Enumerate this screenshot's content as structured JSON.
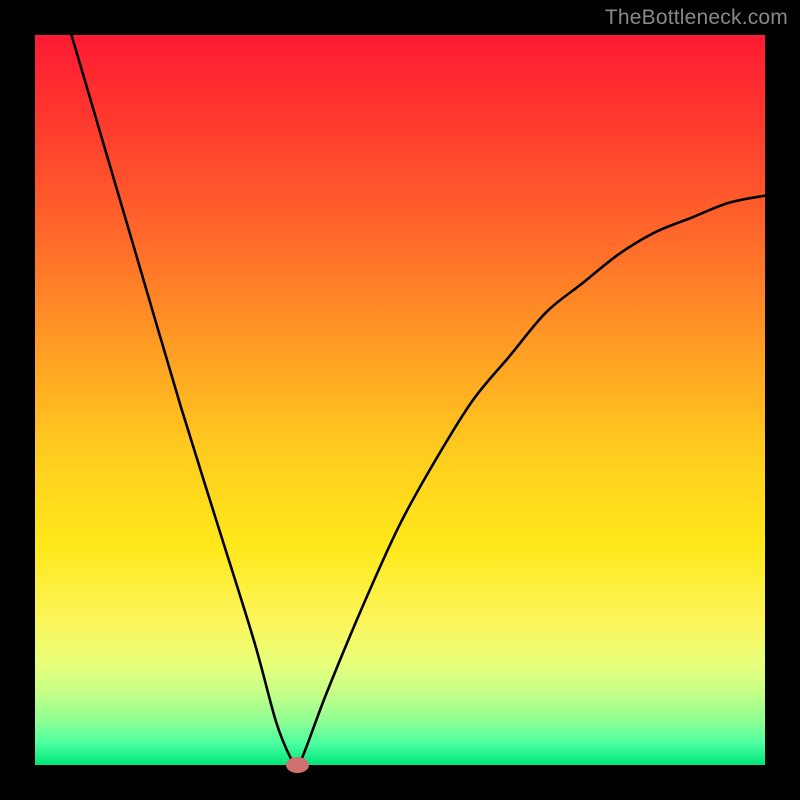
{
  "watermark": "TheBottleneck.com",
  "colors": {
    "background": "#000000",
    "gradient_top": "#ff1a33",
    "gradient_bottom": "#00e57a",
    "curve_stroke": "#000000",
    "marker_fill": "#d07070",
    "watermark_text": "#888888"
  },
  "chart_data": {
    "type": "line",
    "title": "",
    "xlabel": "",
    "ylabel": "",
    "xlim": [
      0,
      100
    ],
    "ylim": [
      0,
      100
    ],
    "grid": false,
    "legend": false,
    "series": [
      {
        "name": "bottleneck-curve",
        "x": [
          5,
          10,
          15,
          20,
          25,
          30,
          33,
          35,
          36,
          37,
          40,
          45,
          50,
          55,
          60,
          65,
          70,
          75,
          80,
          85,
          90,
          95,
          100
        ],
        "values": [
          100,
          83,
          66,
          49,
          33,
          17,
          6,
          1,
          0,
          2,
          10,
          22,
          33,
          42,
          50,
          56,
          62,
          66,
          70,
          73,
          75,
          77,
          78
        ]
      }
    ],
    "marker": {
      "x": 36,
      "y": 0,
      "rx": 1.6,
      "ry": 1.1
    }
  }
}
